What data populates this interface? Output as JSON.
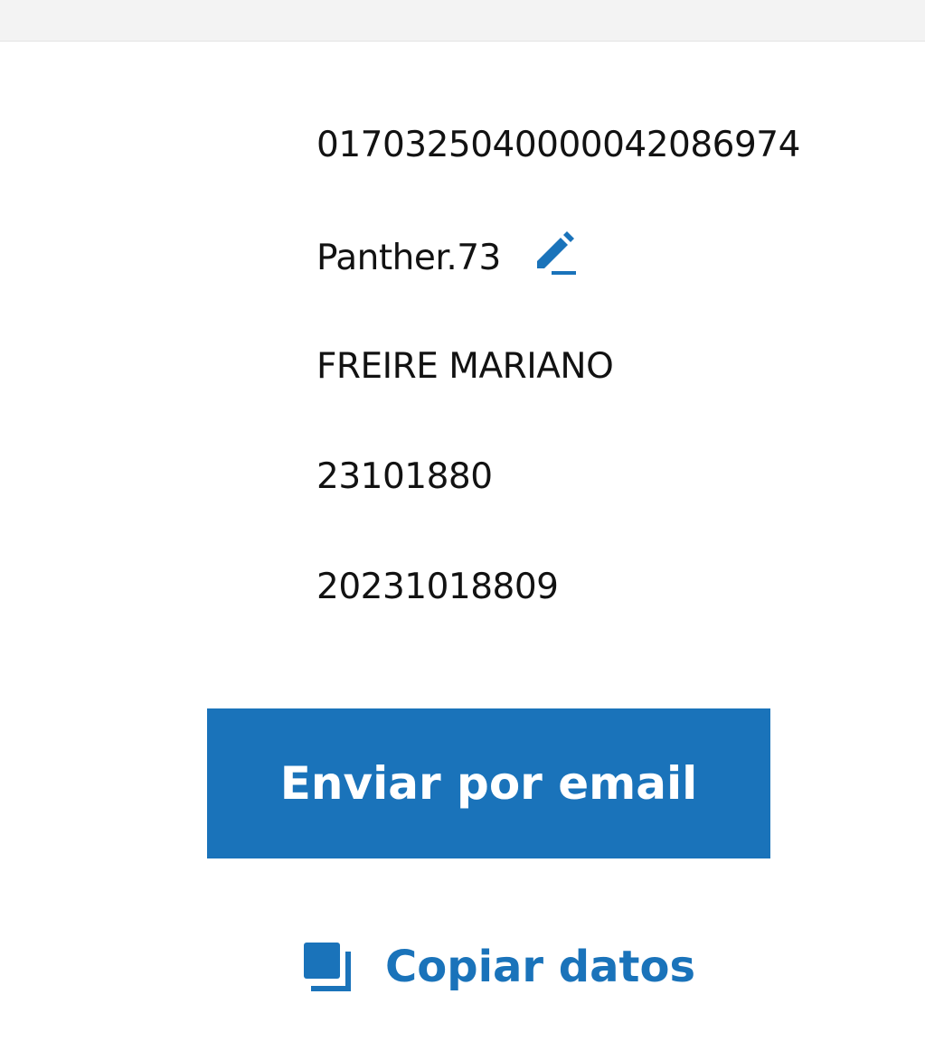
{
  "account": {
    "cbu": "0170325040000042086974",
    "alias": "Panther.73",
    "holder_name": "FREIRE MARIANO",
    "dni": "23101880",
    "cuit": "20231018809"
  },
  "actions": {
    "email_label": "Enviar por email",
    "copy_label": "Copiar datos"
  },
  "icons": {
    "edit": "pencil-icon",
    "copy": "copy-icon"
  },
  "colors": {
    "accent": "#1a73ba",
    "text": "#121212",
    "top_bar": "#f3f3f3"
  }
}
